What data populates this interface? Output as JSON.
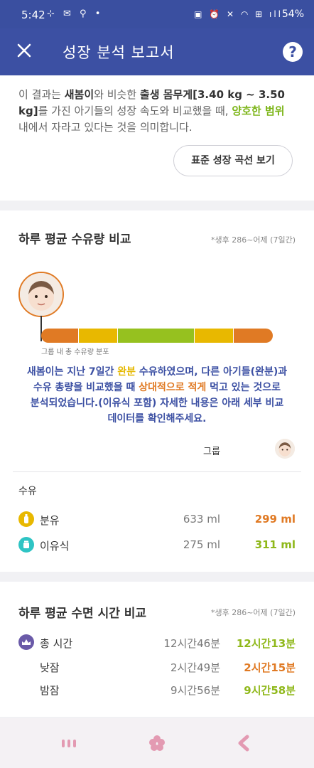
{
  "status_bar": {
    "time": "5:42",
    "left_icons": "⊹ ✉ ⚲ •",
    "right_icons": "▣ ⏰ ✕ ◠ ⊞ ıll",
    "battery": "54%"
  },
  "header": {
    "title": "성장 분석 보고서",
    "close_icon": "close-icon",
    "help_label": "?"
  },
  "intro": {
    "p1": "이 결과는 ",
    "name": "새봄이",
    "p2": "와 비슷한 ",
    "weight_label": "출생 몸무게",
    "weight_range": "[3.40 kg ~ 3.50 kg]",
    "p3": "를 가진 아기들의 성장 속도와 비교했을 때, ",
    "good": "양호한 범위",
    "p4": " 내에서 자라고 있다는 것을 의미합니다.",
    "button": "표준 성장 곡선 보기"
  },
  "feeding": {
    "title": "하루 평균 수유량 비교",
    "period": "*생후 286~어제 (7일간)",
    "bar_caption": "그룹 내 총 수유량 분포",
    "bar_segments": [
      {
        "color": "#e07a24",
        "weight": 16
      },
      {
        "color": "#e8b800",
        "weight": 17
      },
      {
        "color": "#96c11f",
        "weight": 33
      },
      {
        "color": "#e8b800",
        "weight": 17
      },
      {
        "color": "#e07a24",
        "weight": 17
      }
    ],
    "summary": {
      "s1": "새봄이는 지난 7일간 ",
      "s2": "완분",
      "s3": " 수유하였으며, 다른 아기들(완분)과 수유 총량을 비교했을 때 ",
      "s4": "상대적으로 적게",
      "s5": " 먹고 있는 것으로 분석되었습니다.(이유식 포함) 자세한 내용은 아래 세부 비교 데이터를 확인해주세요."
    },
    "group_label": "그룹",
    "section_label": "수유",
    "rows": [
      {
        "label": "분유",
        "icon": "formula-bottle-icon",
        "icon_color": "#e8b800",
        "group": "633 ml",
        "mine": "299 ml",
        "mine_color": "#e07a24"
      },
      {
        "label": "이유식",
        "icon": "baby-food-icon",
        "icon_color": "#2ec4c4",
        "group": "275 ml",
        "mine": "311 ml",
        "mine_color": "#8fb81a"
      }
    ]
  },
  "sleep": {
    "title": "하루 평균 수면 시간 비교",
    "period": "*생후 286~어제 (7일간)",
    "rows": [
      {
        "label": "총 시간",
        "icon": "sleep-icon",
        "group": "12시간46분",
        "mine": "12시간13분",
        "mine_color": "#8fb81a"
      },
      {
        "label": "낮잠",
        "group": "2시간49분",
        "mine": "2시간15분",
        "mine_color": "#e07a24"
      },
      {
        "label": "밤잠",
        "group": "9시간56분",
        "mine": "9시간58분",
        "mine_color": "#8fb81a"
      }
    ]
  },
  "colors": {
    "header": "#3c50a3",
    "orange": "#e07a24",
    "yellow": "#e8b800",
    "green": "#96c11f"
  },
  "navbar": {
    "icons": [
      "recent-apps-icon",
      "home-icon",
      "back-icon"
    ]
  }
}
